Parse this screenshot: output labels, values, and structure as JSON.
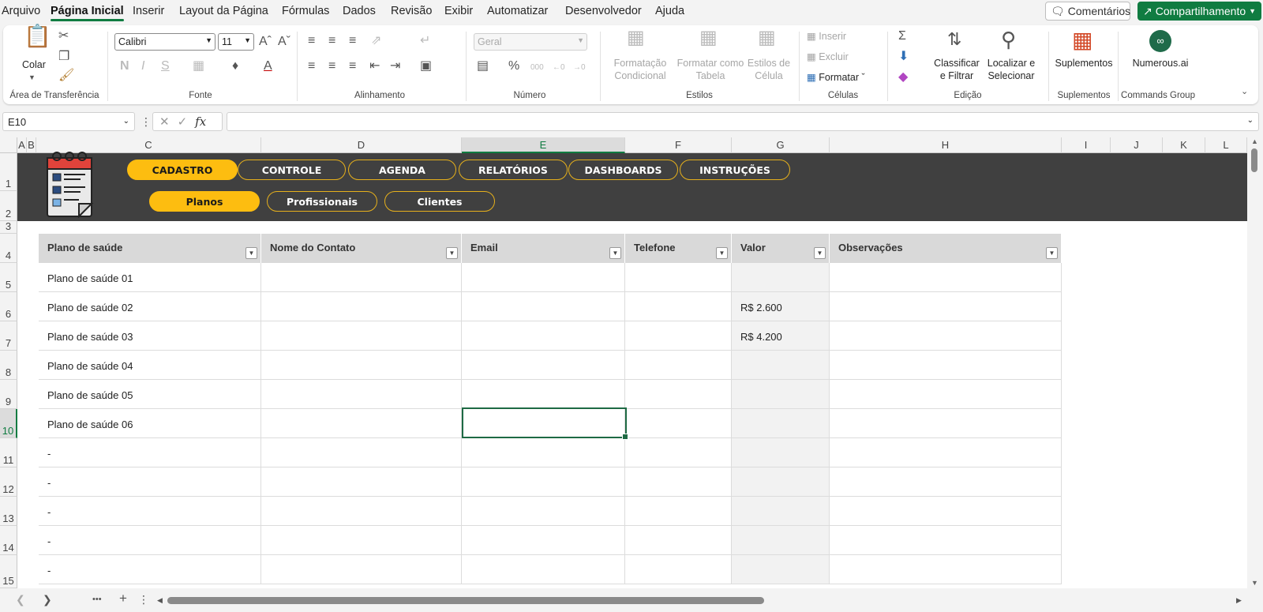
{
  "menu": {
    "items": [
      "Arquivo",
      "Página Inicial",
      "Inserir",
      "Layout da Página",
      "Fórmulas",
      "Dados",
      "Revisão",
      "Exibir",
      "Automatizar",
      "Desenvolvedor",
      "Ajuda"
    ],
    "active": "Página Inicial",
    "comments": "Comentários",
    "share": "Compartilhamento"
  },
  "ribbon": {
    "paste": "Colar",
    "clipboard_group": "Área de Transferência",
    "font_name": "Calibri",
    "font_size": "11",
    "font_group": "Fonte",
    "alignment_group": "Alinhamento",
    "number_format": "Geral",
    "number_group": "Número",
    "cond_format_1": "Formatação",
    "cond_format_2": "Condicional",
    "format_table_1": "Formatar como",
    "format_table_2": "Tabela",
    "cell_styles_1": "Estilos de",
    "cell_styles_2": "Célula",
    "styles_group": "Estilos",
    "insert": "Inserir",
    "delete": "Excluir",
    "format": "Formatar",
    "cells_group": "Células",
    "sort_1": "Classificar",
    "sort_2": "e Filtrar",
    "find_1": "Localizar e",
    "find_2": "Selecionar",
    "editing_group": "Edição",
    "addins": "Suplementos",
    "addins_group": "Suplementos",
    "numerous": "Numerous.ai",
    "commands_group": "Commands Group"
  },
  "formula_bar": {
    "name_box": "E10",
    "fx": "fx",
    "value": ""
  },
  "columns": [
    "A",
    "B",
    "C",
    "D",
    "E",
    "F",
    "G",
    "H",
    "I",
    "J",
    "K",
    "L"
  ],
  "rows": [
    "1",
    "2",
    "3",
    "4",
    "5",
    "6",
    "7",
    "8",
    "9",
    "10",
    "11",
    "12",
    "13",
    "14",
    "15"
  ],
  "nav": {
    "main": [
      "CADASTRO",
      "CONTROLE",
      "AGENDA",
      "RELATÓRIOS",
      "DASHBOARDS",
      "INSTRUÇÕES"
    ],
    "sub": [
      "Planos",
      "Profissionais",
      "Clientes"
    ]
  },
  "table": {
    "headers": [
      "Plano de saúde",
      "Nome do Contato",
      "Email",
      "Telefone",
      "Valor",
      "Observações"
    ],
    "rows": [
      [
        "Plano de saúde 01",
        "",
        "",
        "",
        "",
        ""
      ],
      [
        "Plano de saúde 02",
        "",
        "",
        "",
        "R$ 2.600",
        ""
      ],
      [
        "Plano de saúde 03",
        "",
        "",
        "",
        "R$ 4.200",
        ""
      ],
      [
        "Plano de saúde 04",
        "",
        "",
        "",
        "",
        ""
      ],
      [
        "Plano de saúde 05",
        "",
        "",
        "",
        "",
        ""
      ],
      [
        "Plano de saúde 06",
        "",
        "",
        "",
        "",
        ""
      ],
      [
        "-",
        "",
        "",
        "",
        "",
        ""
      ],
      [
        "-",
        "",
        "",
        "",
        "",
        ""
      ],
      [
        "-",
        "",
        "",
        "",
        "",
        ""
      ],
      [
        "-",
        "",
        "",
        "",
        "",
        ""
      ],
      [
        "-",
        "",
        "",
        "",
        "",
        ""
      ]
    ]
  },
  "sheetbar": {
    "more": "•••",
    "add": "+"
  },
  "colors": {
    "accent": "#107c41",
    "banner": "#404040",
    "pill_active": "#fdbd10"
  }
}
